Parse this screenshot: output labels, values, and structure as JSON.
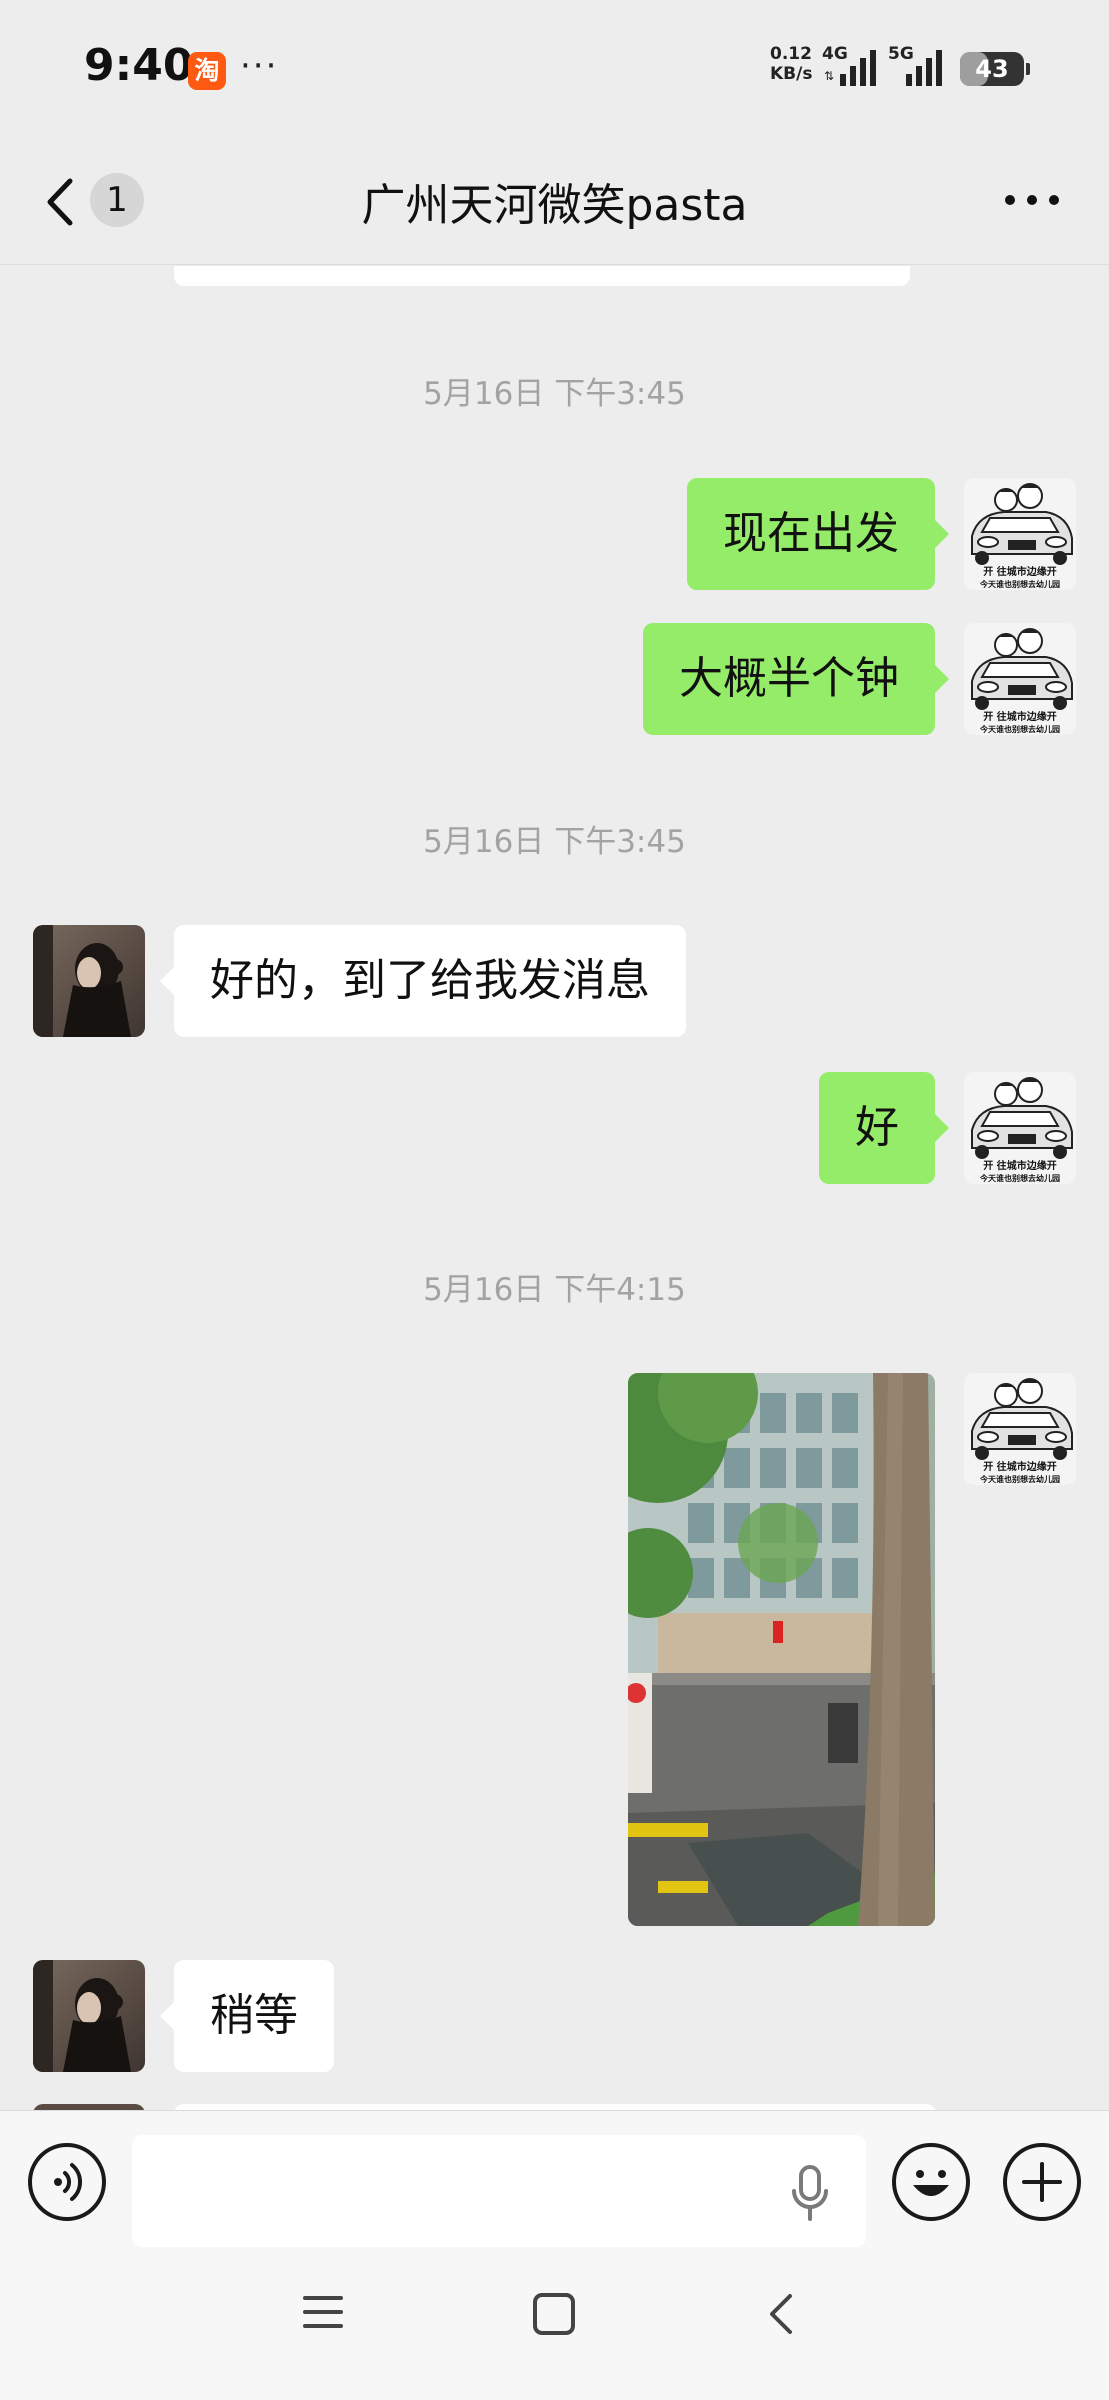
{
  "status_bar": {
    "time": "9:40",
    "app_icon_label": "淘",
    "more_dots": "···",
    "net_speed_value": "0.12",
    "net_speed_unit": "KB/s",
    "sim1_tag": "4G",
    "sim2_tag": "5G",
    "battery_level": "43"
  },
  "nav": {
    "unread_count": "1",
    "title": "广州天河微笑pasta",
    "icons": {
      "back": "chevron-left-icon",
      "more": "more-dots-icon"
    }
  },
  "chat": {
    "messages": [
      {
        "kind": "timestamp",
        "text": "5月16日 下午3:45"
      },
      {
        "kind": "text",
        "from": "me",
        "text": "现在出发"
      },
      {
        "kind": "text",
        "from": "me",
        "text": "大概半个钟"
      },
      {
        "kind": "timestamp",
        "text": "5月16日 下午3:45"
      },
      {
        "kind": "text",
        "from": "them",
        "text": "好的，到了给我发消息"
      },
      {
        "kind": "text",
        "from": "me",
        "text": "好"
      },
      {
        "kind": "timestamp",
        "text": "5月16日 下午4:15"
      },
      {
        "kind": "image",
        "from": "me"
      },
      {
        "kind": "text",
        "from": "them",
        "text": "稍等"
      }
    ],
    "my_avatar_caption_line1": "开 往城市边缘开",
    "my_avatar_caption_line2": "今天谁也别想去幼儿园"
  },
  "input_bar": {
    "icons": {
      "voice": "voice-mode-icon",
      "mic": "microphone-icon",
      "emoji": "emoji-icon",
      "plus": "plus-icon"
    }
  },
  "system_nav": {
    "icons": {
      "menu": "menu-icon",
      "home": "home-square-icon",
      "back": "back-triangle-icon"
    }
  },
  "colors": {
    "background": "#ededed",
    "my_bubble": "#95ec69",
    "their_bubble": "#ffffff",
    "timestamp": "#a3a3a3",
    "accent_app_icon": "#ff5a12"
  }
}
